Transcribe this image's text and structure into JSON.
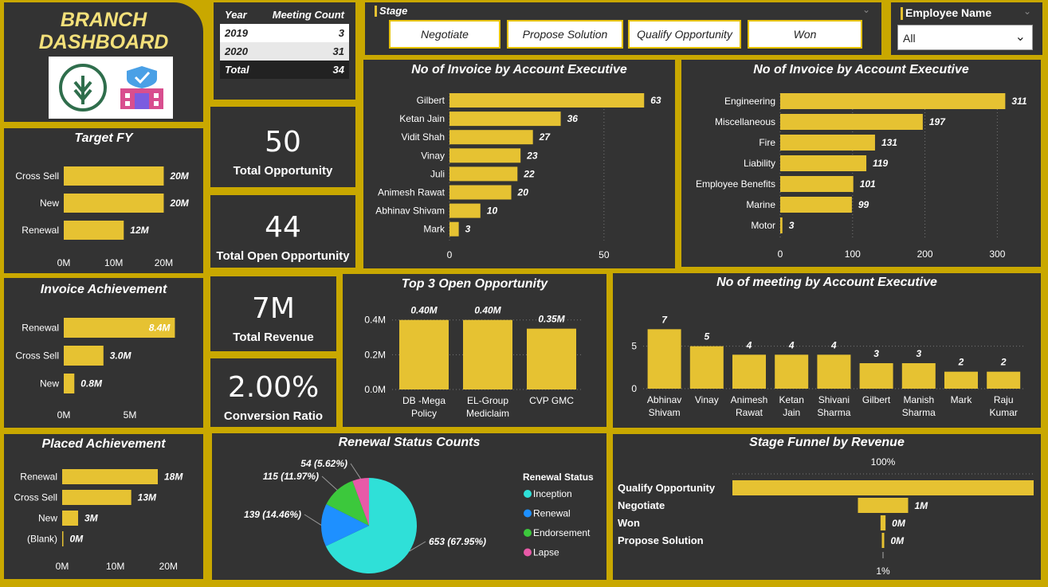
{
  "title_line1": "BRANCH",
  "title_line2": "DASHBOARD",
  "meeting_table": {
    "headers": [
      "Year",
      "Meeting Count"
    ],
    "rows": [
      [
        "2019",
        "3"
      ],
      [
        "2020",
        "31"
      ]
    ],
    "total": [
      "Total",
      "34"
    ]
  },
  "stage_slicer": {
    "label": "Stage",
    "options": [
      "Negotiate",
      "Propose Solution",
      "Qualify Opportunity",
      "Won"
    ]
  },
  "employee_slicer": {
    "label": "Employee Name",
    "value": "All"
  },
  "cards": {
    "total_opportunity": {
      "value": "50",
      "label": "Total Opportunity"
    },
    "total_open_opportunity": {
      "value": "44",
      "label": "Total Open Opportunity"
    },
    "total_revenue": {
      "value": "7M",
      "label": "Total Revenue"
    },
    "conversion_ratio": {
      "value": "2.00%",
      "label": "Conversion Ratio"
    }
  },
  "colors": {
    "bar": "#e6c232",
    "panel": "#333333",
    "border": "#c9a800",
    "inception": "#2fe0d8",
    "renewal": "#1e90ff",
    "endorsement": "#3cc83c",
    "lapse": "#e85aa8"
  },
  "chart_data": [
    {
      "id": "target_fy",
      "type": "bar",
      "orientation": "horizontal",
      "title": "Target FY",
      "categories": [
        "Cross Sell",
        "New",
        "Renewal"
      ],
      "values": [
        20,
        20,
        12
      ],
      "labels": [
        "20M",
        "20M",
        "12M"
      ],
      "ticks": [
        "0M",
        "10M",
        "20M"
      ],
      "xlim": [
        0,
        22
      ]
    },
    {
      "id": "invoice_achievement",
      "type": "bar",
      "orientation": "horizontal",
      "title": "Invoice Achievement",
      "categories": [
        "Renewal",
        "Cross Sell",
        "New"
      ],
      "values": [
        8.4,
        3.0,
        0.8
      ],
      "labels": [
        "8.4M",
        "3.0M",
        "0.8M"
      ],
      "ticks": [
        "0M",
        "5M"
      ],
      "xlim": [
        0,
        10
      ]
    },
    {
      "id": "placed_achievement",
      "type": "bar",
      "orientation": "horizontal",
      "title": "Placed Achievement",
      "categories": [
        "Renewal",
        "Cross Sell",
        "New",
        "(Blank)"
      ],
      "values": [
        18,
        13,
        3,
        0
      ],
      "labels": [
        "18M",
        "13M",
        "3M",
        "0M"
      ],
      "ticks": [
        "0M",
        "10M",
        "20M"
      ],
      "xlim": [
        0,
        21
      ]
    },
    {
      "id": "invoice_by_exec",
      "type": "bar",
      "orientation": "horizontal",
      "title": "No of Invoice by Account Executive",
      "categories": [
        "Gilbert",
        "Ketan Jain",
        "Vidit Shah",
        "Vinay",
        "Juli",
        "Animesh Rawat",
        "Abhinav Shivam",
        "Mark"
      ],
      "values": [
        63,
        36,
        27,
        23,
        22,
        20,
        10,
        3
      ],
      "labels": [
        "63",
        "36",
        "27",
        "23",
        "22",
        "20",
        "10",
        "3"
      ],
      "ticks": [
        "0",
        "50"
      ],
      "xlim": [
        0,
        65
      ]
    },
    {
      "id": "invoice_by_category",
      "type": "bar",
      "orientation": "horizontal",
      "title": "No of Invoice by Account Executive",
      "categories": [
        "Engineering",
        "Miscellaneous",
        "Fire",
        "Liability",
        "Employee Benefits",
        "Marine",
        "Motor"
      ],
      "values": [
        311,
        197,
        131,
        119,
        101,
        99,
        3
      ],
      "labels": [
        "311",
        "197",
        "131",
        "119",
        "101",
        "99",
        "3"
      ],
      "ticks": [
        "0",
        "100",
        "200",
        "300"
      ],
      "xlim": [
        0,
        315
      ]
    },
    {
      "id": "top3_open",
      "type": "bar",
      "orientation": "vertical",
      "title": "Top 3 Open Opportunity",
      "categories": [
        "DB -Mega|Policy",
        "EL-Group|Mediclaim",
        "CVP GMC"
      ],
      "values": [
        0.4,
        0.4,
        0.35
      ],
      "labels": [
        "0.40M",
        "0.40M",
        "0.35M"
      ],
      "yticks": [
        "0.0M",
        "0.2M",
        "0.4M"
      ],
      "ylim": [
        0,
        0.44
      ]
    },
    {
      "id": "meetings_by_exec",
      "type": "bar",
      "orientation": "vertical",
      "title": "No of meeting by Account Executive",
      "categories": [
        "Abhinav|Shivam",
        "Vinay",
        "Animesh|Rawat",
        "Ketan|Jain",
        "Shivani|Sharma",
        "Gilbert",
        "Manish|Sharma",
        "Mark",
        "Raju|Kumar"
      ],
      "values": [
        7,
        5,
        4,
        4,
        4,
        3,
        3,
        2,
        2
      ],
      "labels": [
        "7",
        "5",
        "4",
        "4",
        "4",
        "3",
        "3",
        "2",
        "2"
      ],
      "yticks": [
        "0",
        "5"
      ],
      "ylim": [
        0,
        7.5
      ]
    },
    {
      "id": "renewal_status",
      "type": "pie",
      "title": "Renewal Status Counts",
      "legend_title": "Renewal Status",
      "slices": [
        {
          "name": "Inception",
          "value": 653,
          "label": "653 (67.95%)"
        },
        {
          "name": "Renewal",
          "value": 139,
          "label": "139 (14.46%)"
        },
        {
          "name": "Endorsement",
          "value": 115,
          "label": "115 (11.97%)"
        },
        {
          "name": "Lapse",
          "value": 54,
          "label": "54 (5.62%)"
        }
      ]
    },
    {
      "id": "stage_funnel",
      "type": "bar",
      "orientation": "funnel",
      "title": "Stage Funnel by Revenue",
      "categories": [
        "Qualify Opportunity",
        "Negotiate",
        "Won",
        "Propose Solution"
      ],
      "values": [
        6.0,
        1.0,
        0.1,
        0.03
      ],
      "labels": [
        "",
        "1M",
        "0M",
        "0M"
      ],
      "top_label": "100%",
      "bottom_label": "1%"
    }
  ]
}
